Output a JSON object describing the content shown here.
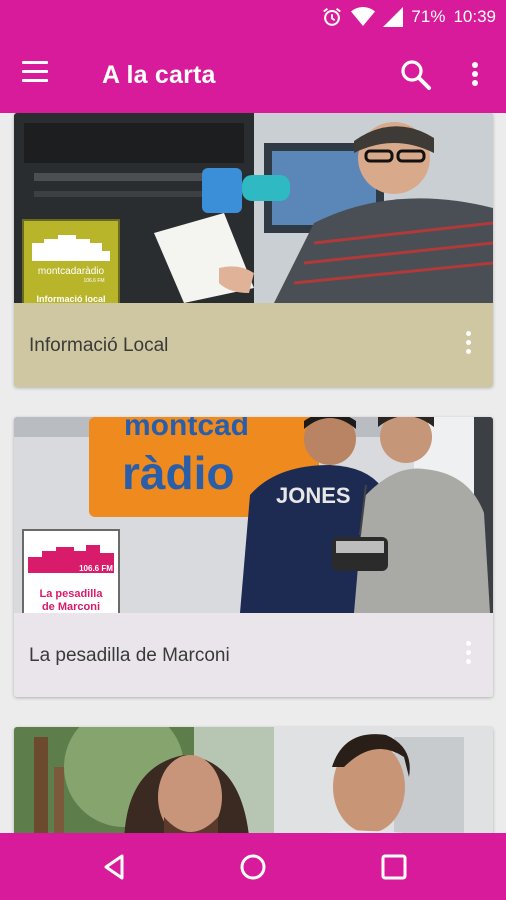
{
  "status_bar": {
    "battery": "71%",
    "time": "10:39"
  },
  "app_bar": {
    "title": "A la carta",
    "icons": [
      "menu-icon",
      "search-icon",
      "more-vert-icon"
    ]
  },
  "cards": [
    {
      "title": "Informació Local",
      "footer_color": "#cfc7a1",
      "logo": {
        "bg": "#b8b52a",
        "brand_line1": "montcadaràdio",
        "brand_freq": "106.6 FM",
        "caption": "Informació local"
      }
    },
    {
      "title": "La pesadilla de Marconi",
      "footer_color": "#e9e5ea",
      "logo": {
        "bg": "#ffffff",
        "freq": "106.6 FM",
        "caption_line1": "La pesadilla",
        "caption_line2": "de Marconi"
      },
      "image_text": {
        "sign": "ràdio",
        "sign_top": "montcad",
        "shirt": "JONES"
      }
    },
    {
      "title": "",
      "footer_color": "#e9e5ea"
    }
  ],
  "nav_bar": {
    "icons": [
      "back-icon",
      "home-icon",
      "recents-icon"
    ]
  },
  "colors": {
    "primary": "#d81b9a",
    "background": "#ececec"
  }
}
